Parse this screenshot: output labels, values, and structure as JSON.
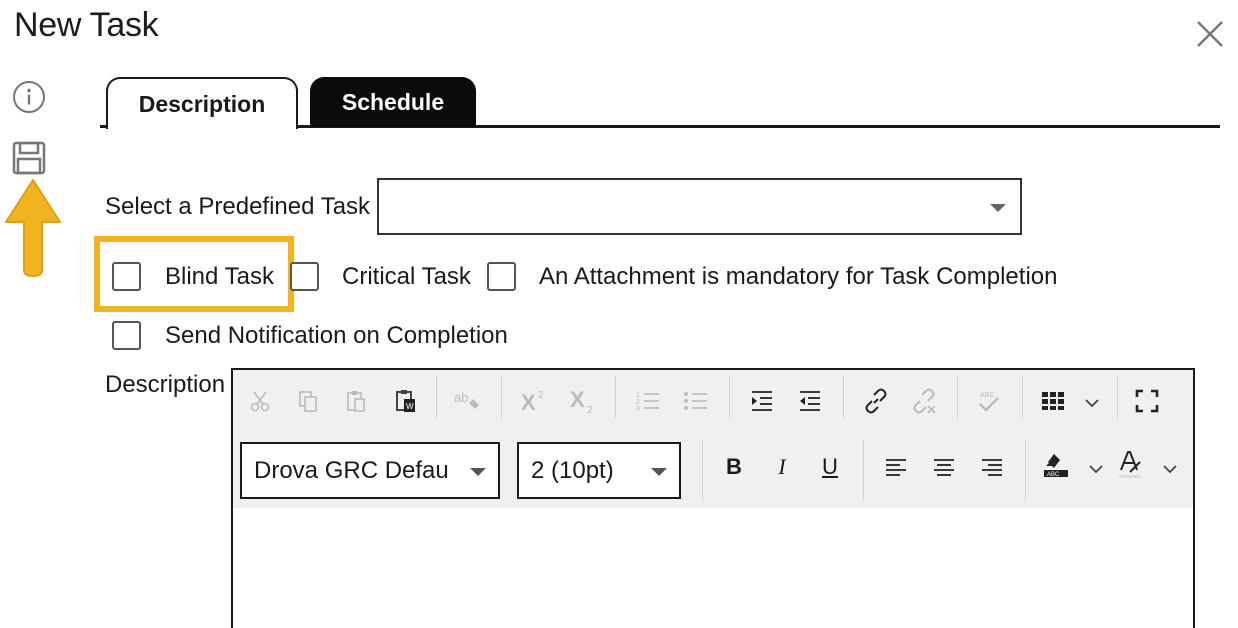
{
  "dialog": {
    "title": "New Task"
  },
  "tabs": [
    {
      "label": "Description"
    },
    {
      "label": "Schedule"
    }
  ],
  "form": {
    "predefined_label": "Select a Predefined Task",
    "predefined_value": "",
    "checkboxes": {
      "blind": "Blind Task",
      "critical": "Critical Task",
      "attachment": "An Attachment is mandatory for Task Completion",
      "notify": "Send Notification on Completion"
    },
    "description_label": "Description"
  },
  "editor": {
    "font_value": "Drova GRC Default",
    "size_value": "2 (10pt)",
    "bold": "B",
    "italic": "I",
    "underline": "U",
    "superscript": "X",
    "subscript": "X",
    "spell": "ab",
    "spellcheck": "ABC",
    "highlight_abc": "ABC",
    "body_text": ""
  },
  "colors": {
    "highlight": "#f2b321",
    "active_tab_bg": "#ffffff",
    "inactive_tab_bg": "#0c0c0c"
  }
}
